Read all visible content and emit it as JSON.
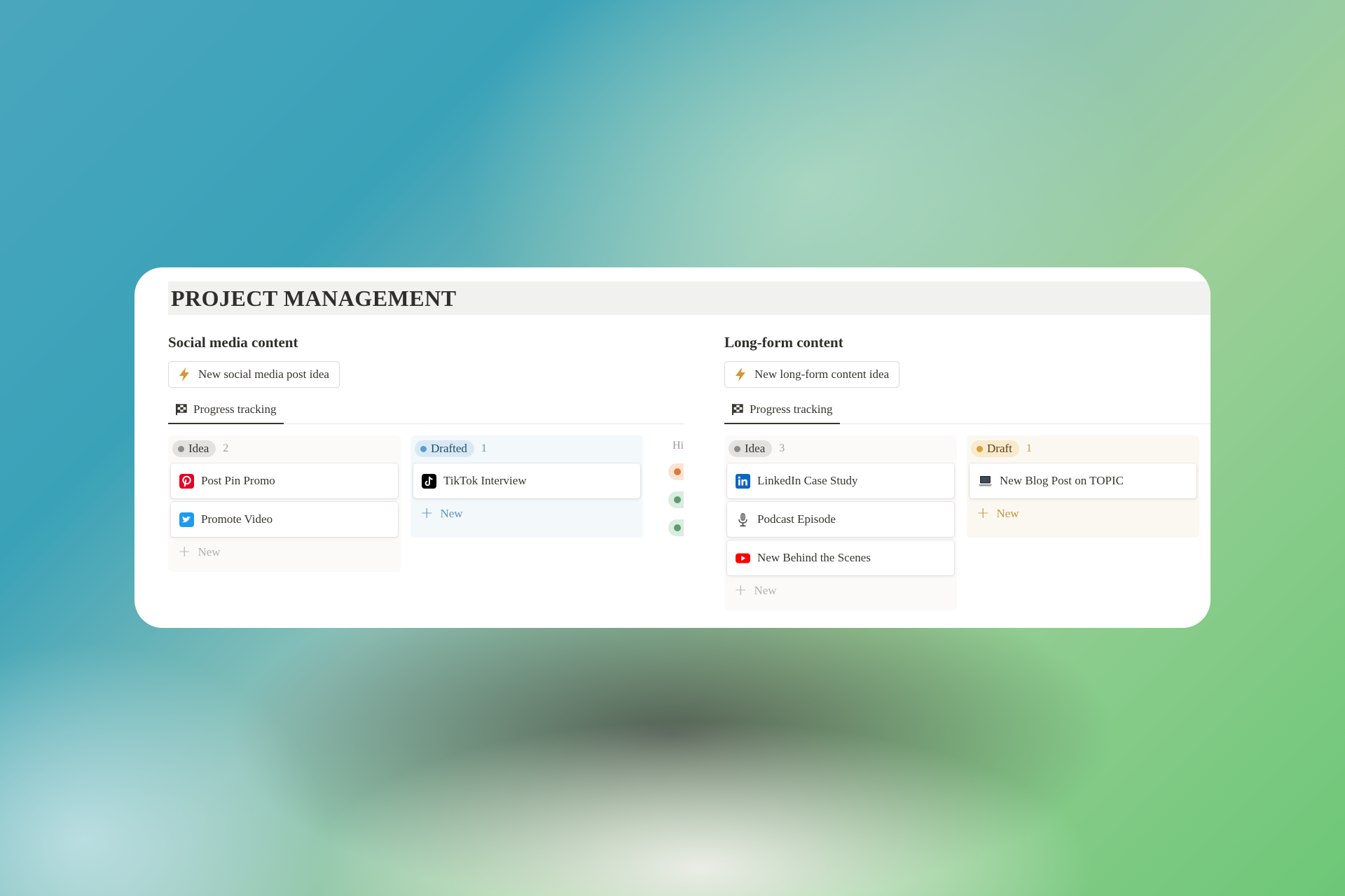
{
  "page": {
    "title": "PROJECT MANAGEMENT"
  },
  "sections": [
    {
      "title": "Social media content",
      "action_label": "New social media post idea",
      "tab_label": "Progress tracking",
      "columns": [
        {
          "status": "Idea",
          "count": "2",
          "items": [
            {
              "label": "Post Pin Promo",
              "icon": "pinterest-icon"
            },
            {
              "label": "Promote Video",
              "icon": "twitter-icon"
            }
          ],
          "new_label": "New"
        },
        {
          "status": "Drafted",
          "count": "1",
          "items": [
            {
              "label": "TikTok Interview",
              "icon": "tiktok-icon"
            }
          ],
          "new_label": "New"
        }
      ],
      "hidden_group_label": "Hidden groups"
    },
    {
      "title": "Long-form content",
      "action_label": "New long-form content idea",
      "tab_label": "Progress tracking",
      "columns": [
        {
          "status": "Idea",
          "count": "3",
          "items": [
            {
              "label": "LinkedIn Case Study",
              "icon": "linkedin-icon"
            },
            {
              "label": "Podcast Episode",
              "icon": "microphone-icon"
            },
            {
              "label": "New Behind the Scenes",
              "icon": "youtube-icon"
            }
          ],
          "new_label": "New"
        },
        {
          "status": "Draft",
          "count": "1",
          "items": [
            {
              "label": "New Blog Post on TOPIC",
              "icon": "laptop-icon"
            }
          ],
          "new_label": "New"
        }
      ]
    }
  ],
  "colors": {
    "idea_pill": "#e3e2e0",
    "drafted_pill": "#d9e9f4",
    "draft_pill": "#f8eacc",
    "accent_bolt": "#d9962e"
  }
}
